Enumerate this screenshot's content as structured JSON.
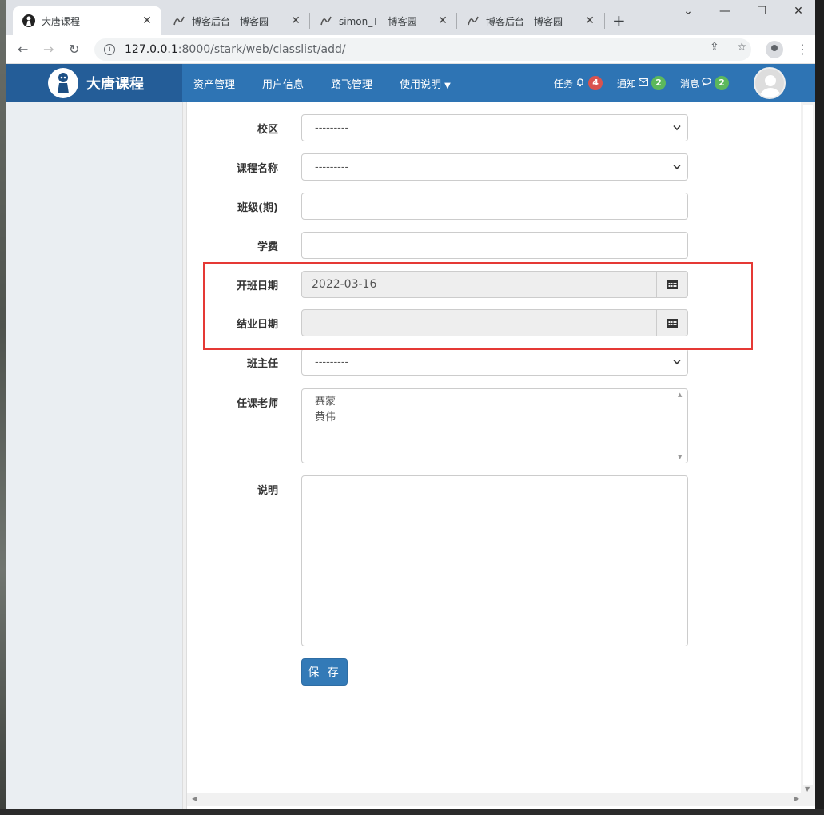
{
  "browser": {
    "tabs": [
      {
        "title": "大唐课程",
        "active": true
      },
      {
        "title": "博客后台 - 博客园",
        "active": false
      },
      {
        "title": "simon_T - 博客园",
        "active": false
      },
      {
        "title": "博客后台 - 博客园",
        "active": false
      }
    ],
    "new_tab": "+",
    "url_host": "127.0.0.1",
    "url_rest": ":8000/stark/web/classlist/add/"
  },
  "app": {
    "brand": "大唐课程",
    "menu": [
      "资产管理",
      "用户信息",
      "路飞管理",
      "使用说明"
    ],
    "tasks": {
      "label": "任务",
      "count": "4"
    },
    "notices": {
      "label": "通知",
      "count": "2"
    },
    "messages": {
      "label": "消息",
      "count": "2"
    },
    "colors": {
      "navbar": "#2e74b4",
      "brand_bg": "#245d98",
      "badge_red": "#d9534f",
      "badge_green": "#5cb85c",
      "highlight": "#e53935"
    }
  },
  "form": {
    "campus": {
      "label": "校区",
      "value": "---------"
    },
    "course": {
      "label": "课程名称",
      "value": "---------"
    },
    "semester": {
      "label": "班级(期)",
      "value": ""
    },
    "price": {
      "label": "学费",
      "value": ""
    },
    "start_date": {
      "label": "开班日期",
      "value": "2022-03-16"
    },
    "graduate_date": {
      "label": "结业日期",
      "value": ""
    },
    "tutor": {
      "label": "班主任",
      "value": "---------"
    },
    "teachers": {
      "label": "任课老师",
      "options": [
        "赛蒙",
        "黄伟"
      ]
    },
    "memo": {
      "label": "说明",
      "value": ""
    },
    "save": "保 存"
  }
}
